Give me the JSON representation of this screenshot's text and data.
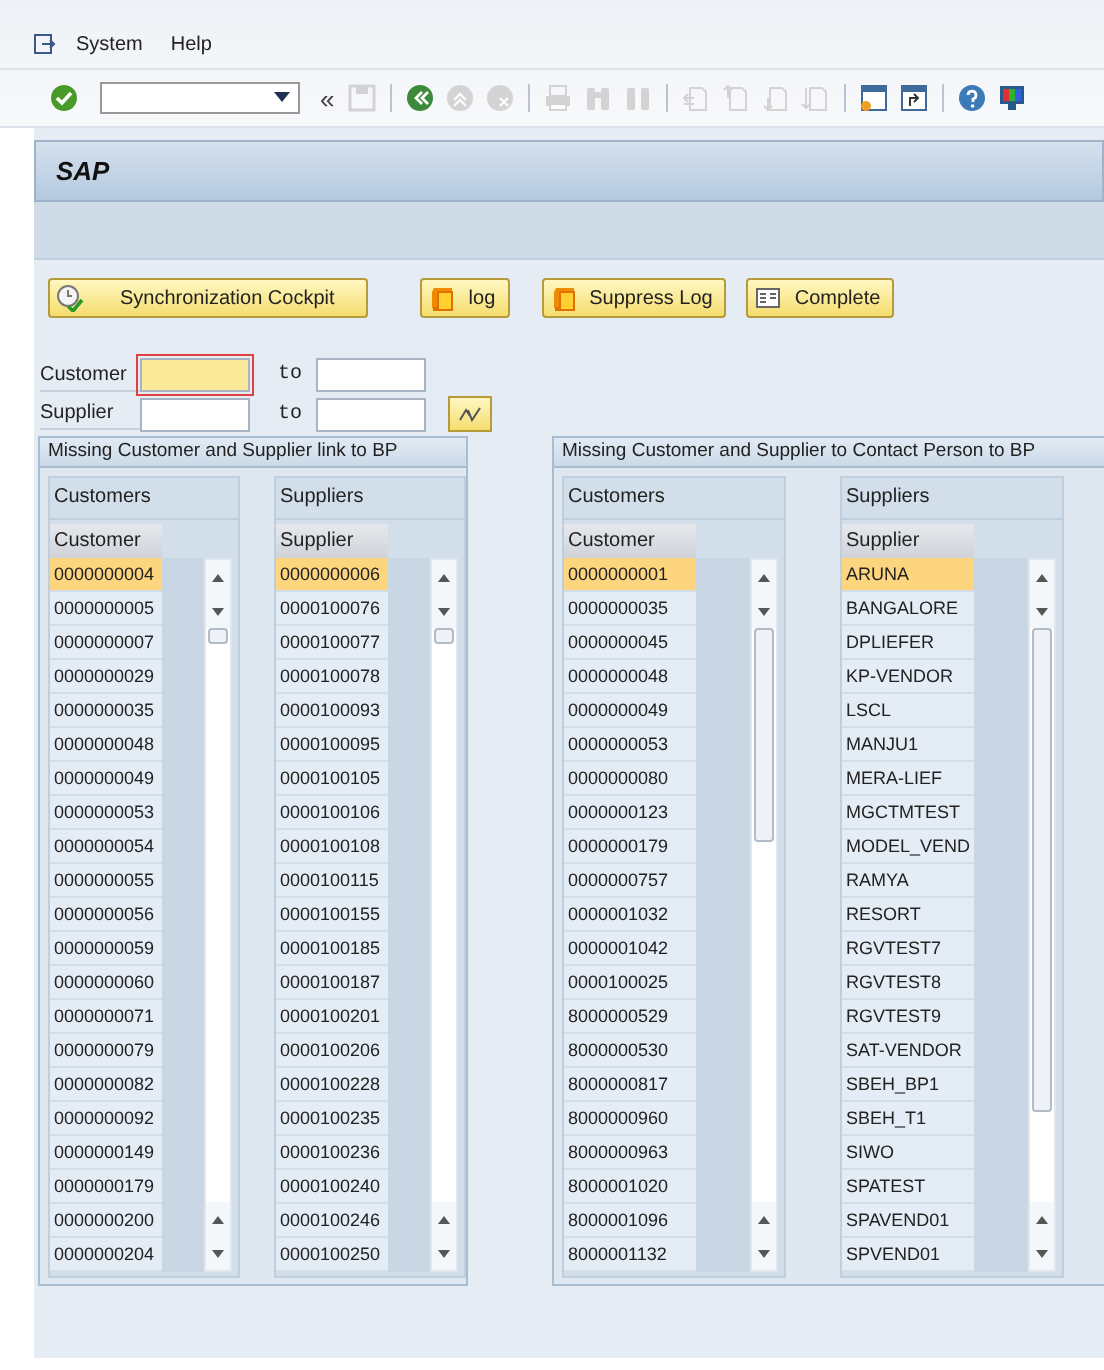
{
  "menu": [
    {
      "label": "System"
    },
    {
      "label": "Help"
    }
  ],
  "toolbar": [
    {
      "kind": "enter",
      "disabled": false
    },
    {
      "kind": "command"
    },
    {
      "kind": "collapse",
      "text": "«"
    },
    {
      "kind": "save",
      "disabled": true
    },
    {
      "kind": "back",
      "disabled": false
    },
    {
      "kind": "exit",
      "disabled": true
    },
    {
      "kind": "cancel",
      "disabled": true
    },
    {
      "kind": "print",
      "disabled": true
    },
    {
      "kind": "find",
      "disabled": true
    },
    {
      "kind": "find-next",
      "disabled": true
    },
    {
      "kind": "first-page",
      "disabled": true
    },
    {
      "kind": "prev-page",
      "disabled": true
    },
    {
      "kind": "next-page",
      "disabled": true
    },
    {
      "kind": "last-page",
      "disabled": true
    },
    {
      "kind": "new-session",
      "disabled": false
    },
    {
      "kind": "shortcut",
      "disabled": false
    },
    {
      "kind": "help",
      "disabled": false
    },
    {
      "kind": "layout",
      "disabled": false
    }
  ],
  "title": "SAP",
  "buttons": [
    {
      "label": "Synchronization Cockpit",
      "kind": "cockpit"
    },
    {
      "label": "log",
      "kind": "log"
    },
    {
      "label": "Suppress Log",
      "kind": "log"
    },
    {
      "label": "Complete",
      "kind": "complete"
    }
  ],
  "selection": [
    {
      "label": "Customer",
      "to": "to",
      "focused": true
    },
    {
      "label": "Supplier",
      "to": "to",
      "focused": false
    }
  ],
  "panels": [
    {
      "title": "Missing Customer and Supplier link to BP",
      "lists": [
        {
          "group": "Customers",
          "column": "Customer",
          "rows": [
            {
              "value": "0000000004",
              "selected": true
            },
            {
              "value": "0000000005",
              "selected": false
            },
            {
              "value": "0000000007",
              "selected": false
            },
            {
              "value": "0000000029",
              "selected": false
            },
            {
              "value": "0000000035",
              "selected": false
            },
            {
              "value": "0000000048",
              "selected": false
            },
            {
              "value": "0000000049",
              "selected": false
            },
            {
              "value": "0000000053",
              "selected": false
            },
            {
              "value": "0000000054",
              "selected": false
            },
            {
              "value": "0000000055",
              "selected": false
            },
            {
              "value": "0000000056",
              "selected": false
            },
            {
              "value": "0000000059",
              "selected": false
            },
            {
              "value": "0000000060",
              "selected": false
            },
            {
              "value": "0000000071",
              "selected": false
            },
            {
              "value": "0000000079",
              "selected": false
            },
            {
              "value": "0000000082",
              "selected": false
            },
            {
              "value": "0000000092",
              "selected": false
            },
            {
              "value": "0000000149",
              "selected": false
            },
            {
              "value": "0000000179",
              "selected": false
            },
            {
              "value": "0000000200",
              "selected": false
            },
            {
              "value": "0000000204",
              "selected": false
            }
          ]
        },
        {
          "group": "Suppliers",
          "column": "Supplier",
          "rows": [
            {
              "value": "0000000006",
              "selected": true
            },
            {
              "value": "0000100076",
              "selected": false
            },
            {
              "value": "0000100077",
              "selected": false
            },
            {
              "value": "0000100078",
              "selected": false
            },
            {
              "value": "0000100093",
              "selected": false
            },
            {
              "value": "0000100095",
              "selected": false
            },
            {
              "value": "0000100105",
              "selected": false
            },
            {
              "value": "0000100106",
              "selected": false
            },
            {
              "value": "0000100108",
              "selected": false
            },
            {
              "value": "0000100115",
              "selected": false
            },
            {
              "value": "0000100155",
              "selected": false
            },
            {
              "value": "0000100185",
              "selected": false
            },
            {
              "value": "0000100187",
              "selected": false
            },
            {
              "value": "0000100201",
              "selected": false
            },
            {
              "value": "0000100206",
              "selected": false
            },
            {
              "value": "0000100228",
              "selected": false
            },
            {
              "value": "0000100235",
              "selected": false
            },
            {
              "value": "0000100236",
              "selected": false
            },
            {
              "value": "0000100240",
              "selected": false
            },
            {
              "value": "0000100246",
              "selected": false
            },
            {
              "value": "0000100250",
              "selected": false
            }
          ]
        }
      ]
    },
    {
      "title": "Missing Customer and Supplier to Contact Person to BP",
      "lists": [
        {
          "group": "Customers",
          "column": "Customer",
          "rows": [
            {
              "value": "0000000001",
              "selected": true
            },
            {
              "value": "0000000035",
              "selected": false
            },
            {
              "value": "0000000045",
              "selected": false
            },
            {
              "value": "0000000048",
              "selected": false
            },
            {
              "value": "0000000049",
              "selected": false
            },
            {
              "value": "0000000053",
              "selected": false
            },
            {
              "value": "0000000080",
              "selected": false
            },
            {
              "value": "0000000123",
              "selected": false
            },
            {
              "value": "0000000179",
              "selected": false
            },
            {
              "value": "0000000757",
              "selected": false
            },
            {
              "value": "0000001032",
              "selected": false
            },
            {
              "value": "0000001042",
              "selected": false
            },
            {
              "value": "0000100025",
              "selected": false
            },
            {
              "value": "8000000529",
              "selected": false
            },
            {
              "value": "8000000530",
              "selected": false
            },
            {
              "value": "8000000817",
              "selected": false
            },
            {
              "value": "8000000960",
              "selected": false
            },
            {
              "value": "8000000963",
              "selected": false
            },
            {
              "value": "8000001020",
              "selected": false
            },
            {
              "value": "8000001096",
              "selected": false
            },
            {
              "value": "8000001132",
              "selected": false
            }
          ]
        },
        {
          "group": "Suppliers",
          "column": "Supplier",
          "rows": [
            {
              "value": "ARUNA",
              "selected": true
            },
            {
              "value": "BANGALORE",
              "selected": false
            },
            {
              "value": "DPLIEFER",
              "selected": false
            },
            {
              "value": "KP-VENDOR",
              "selected": false
            },
            {
              "value": "LSCL",
              "selected": false
            },
            {
              "value": "MANJU1",
              "selected": false
            },
            {
              "value": "MERA-LIEF",
              "selected": false
            },
            {
              "value": "MGCTMTEST",
              "selected": false
            },
            {
              "value": "MODEL_VEND",
              "selected": false
            },
            {
              "value": "RAMYA",
              "selected": false
            },
            {
              "value": "RESORT",
              "selected": false
            },
            {
              "value": "RGVTEST7",
              "selected": false
            },
            {
              "value": "RGVTEST8",
              "selected": false
            },
            {
              "value": "RGVTEST9",
              "selected": false
            },
            {
              "value": "SAT-VENDOR",
              "selected": false
            },
            {
              "value": "SBEH_BP1",
              "selected": false
            },
            {
              "value": "SBEH_T1",
              "selected": false
            },
            {
              "value": "SIWO",
              "selected": false
            },
            {
              "value": "SPATEST",
              "selected": false
            },
            {
              "value": "SPAVEND01",
              "selected": false
            },
            {
              "value": "SPVEND01",
              "selected": false
            }
          ]
        }
      ]
    }
  ]
}
